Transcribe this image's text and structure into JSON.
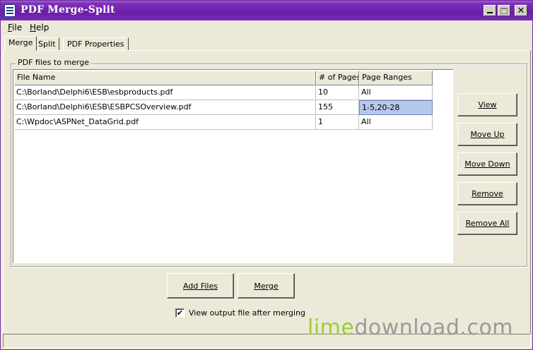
{
  "window": {
    "title": "PDF Merge-Split"
  },
  "menu": [
    {
      "label": "File",
      "key": "F",
      "rest": "ile"
    },
    {
      "label": "Help",
      "key": "H",
      "rest": "elp"
    }
  ],
  "tabs": [
    "Merge",
    "Split",
    "PDF Properties"
  ],
  "group_title": "PDF files to merge",
  "grid": {
    "headers": [
      "File Name",
      "# of Pages",
      "Page Ranges"
    ],
    "rows": [
      [
        "C:\\Borland\\Delphi6\\ESB\\esbproducts.pdf",
        "10",
        "All"
      ],
      [
        "C:\\Borland\\Delphi6\\ESB\\ESBPCSOverview.pdf",
        "155",
        "1-5,20-28"
      ],
      [
        "C:\\Wpdoc\\ASPNet_DataGrid.pdf",
        "1",
        "All"
      ]
    ]
  },
  "side_buttons": [
    "View",
    "Move Up",
    "Move Down",
    "Remove",
    "Remove All"
  ],
  "bottom_buttons": [
    "Add Files",
    "Merge"
  ],
  "checkbox": {
    "label": "View output file after merging",
    "checked": true
  },
  "watermark": {
    "part1": "lime",
    "part2": "download.com"
  },
  "colors": {
    "titlebar": "#6a1ea8",
    "selection": "#b6c8ea",
    "face": "#ece9d8",
    "watermark_green": "#9ccc3a"
  }
}
